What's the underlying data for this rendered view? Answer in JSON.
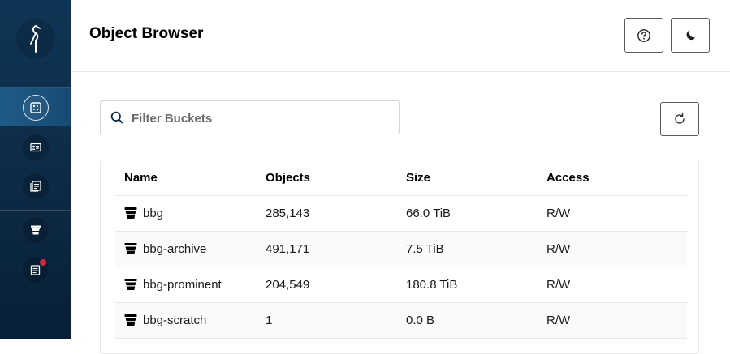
{
  "header": {
    "title": "Object Browser",
    "help_icon": "help-circle-icon",
    "theme_icon": "moon-icon"
  },
  "sidebar": {
    "logo": "minio-bird-logo",
    "items": [
      {
        "icon": "buckets-grid-icon",
        "active": true
      },
      {
        "icon": "identity-card-icon",
        "active": false
      },
      {
        "icon": "documents-icon",
        "active": false
      },
      {
        "icon": "bucket-stack-icon",
        "active": false
      },
      {
        "icon": "license-notification-icon",
        "active": false,
        "badge": true
      }
    ]
  },
  "search": {
    "placeholder": "Filter Buckets",
    "value": ""
  },
  "table": {
    "columns": [
      "Name",
      "Objects",
      "Size",
      "Access"
    ],
    "rows": [
      {
        "name": "bbg",
        "objects": "285,143",
        "size": "66.0 TiB",
        "access": "R/W"
      },
      {
        "name": "bbg-archive",
        "objects": "491,171",
        "size": "7.5 TiB",
        "access": "R/W"
      },
      {
        "name": "bbg-prominent",
        "objects": "204,549",
        "size": "180.8 TiB",
        "access": "R/W"
      },
      {
        "name": "bbg-scratch",
        "objects": "1",
        "size": "0.0 B",
        "access": "R/W"
      }
    ]
  },
  "colors": {
    "sidebar": "#0d2b47",
    "active_nav": "#1f5a86",
    "badge": "#d0283c"
  }
}
